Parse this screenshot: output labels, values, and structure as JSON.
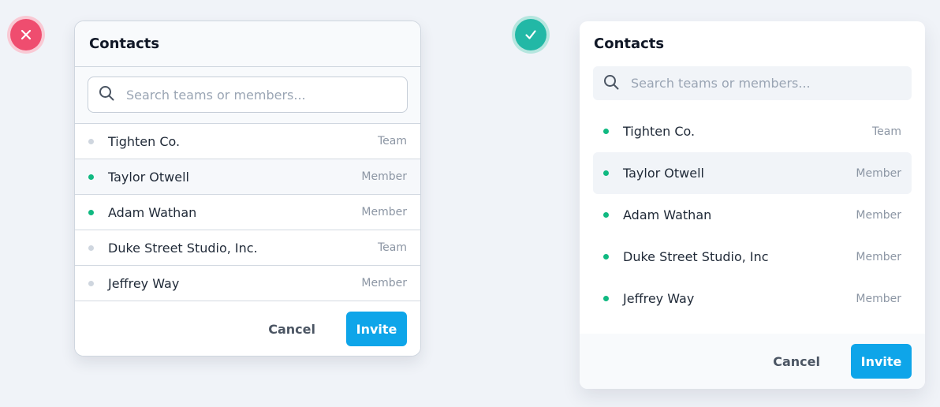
{
  "colors": {
    "bad_badge": "#ef4d6f",
    "good_badge": "#22b8a6",
    "online_dot": "#10b981",
    "offline_dot": "#cfd6df",
    "accent": "#0ea5e9"
  },
  "badges": {
    "bad_icon": "x-icon",
    "good_icon": "check-icon"
  },
  "bad_card": {
    "title": "Contacts",
    "search": {
      "placeholder": "Search teams or members...",
      "value": ""
    },
    "rows": [
      {
        "name": "Tighten Co.",
        "type": "Team",
        "online": false
      },
      {
        "name": "Taylor Otwell",
        "type": "Member",
        "online": true
      },
      {
        "name": "Adam Wathan",
        "type": "Member",
        "online": true
      },
      {
        "name": "Duke Street Studio, Inc.",
        "type": "Team",
        "online": false
      },
      {
        "name": "Jeffrey Way",
        "type": "Member",
        "online": false
      }
    ],
    "cancel_label": "Cancel",
    "invite_label": "Invite"
  },
  "good_card": {
    "title": "Contacts",
    "search": {
      "placeholder": "Search teams or members...",
      "value": ""
    },
    "rows": [
      {
        "name": "Tighten Co.",
        "type": "Team",
        "online": true
      },
      {
        "name": "Taylor Otwell",
        "type": "Member",
        "online": true
      },
      {
        "name": "Adam Wathan",
        "type": "Member",
        "online": true
      },
      {
        "name": "Duke Street Studio, Inc",
        "type": "Member",
        "online": true
      },
      {
        "name": "Jeffrey Way",
        "type": "Member",
        "online": true
      }
    ],
    "cancel_label": "Cancel",
    "invite_label": "Invite"
  }
}
